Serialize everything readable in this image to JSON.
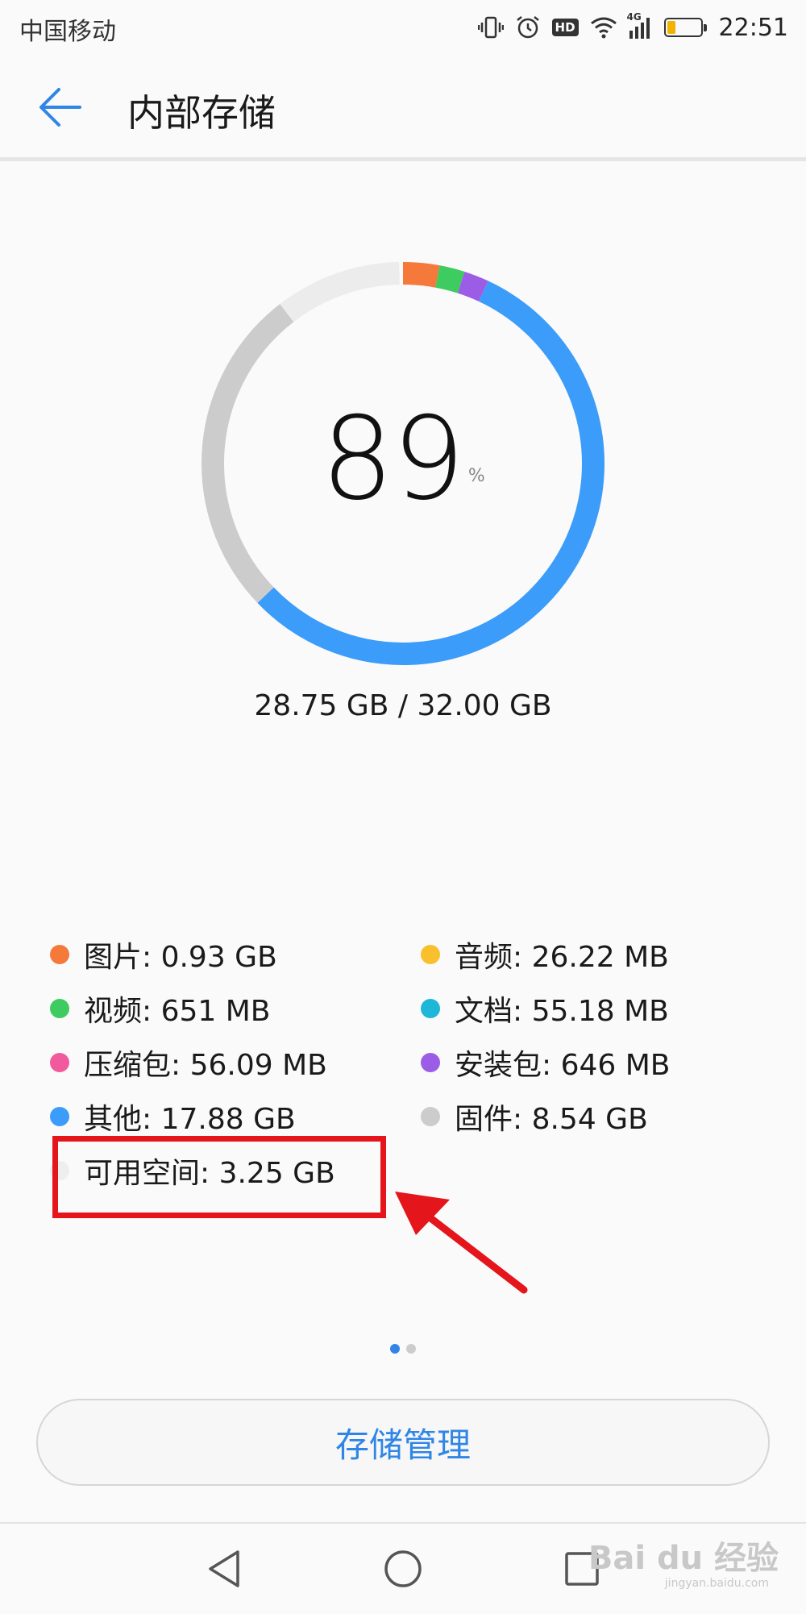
{
  "status_bar": {
    "carrier": "中国移动",
    "network": "4G",
    "hd": "HD",
    "time": "22:51",
    "battery_level": 0.28
  },
  "app_bar": {
    "title": "内部存储"
  },
  "storage": {
    "percent": "89",
    "percent_unit": "%",
    "usage": "28.75 GB / 32.00 GB"
  },
  "chart_data": {
    "type": "donut",
    "total_gb": 32.0,
    "segments": [
      {
        "name": "图片",
        "value_gb": 0.93,
        "color": "#f5793a"
      },
      {
        "name": "视频",
        "value_gb": 0.651,
        "color": "#3ecb5f"
      },
      {
        "name": "安装包",
        "value_gb": 0.646,
        "color": "#9b5de5"
      },
      {
        "name": "其他",
        "value_gb": 17.88,
        "color": "#3c9cf9"
      },
      {
        "name": "固件",
        "value_gb": 8.54,
        "color": "#cccccc"
      },
      {
        "name": "可用空间",
        "value_gb": 3.25,
        "color": "#ececec"
      }
    ]
  },
  "legend": {
    "items": [
      {
        "text": "图片: 0.93 GB",
        "color": "#f5793a"
      },
      {
        "text": "音频: 26.22 MB",
        "color": "#f9c02e"
      },
      {
        "text": "视频: 651 MB",
        "color": "#3ecb5f"
      },
      {
        "text": "文档: 55.18 MB",
        "color": "#1fb7d9"
      },
      {
        "text": "压缩包: 56.09 MB",
        "color": "#f15a9c"
      },
      {
        "text": "安装包: 646 MB",
        "color": "#9b5de5"
      },
      {
        "text": "其他: 17.88 GB",
        "color": "#3c9cf9"
      },
      {
        "text": "固件: 8.54 GB",
        "color": "#cccccc"
      },
      {
        "text": "可用空间: 3.25 GB",
        "color": "#eeeeee"
      }
    ]
  },
  "page_indicator": {
    "active_color": "#2f86e6",
    "inactive_color": "#cccccc"
  },
  "actions": {
    "manage_label": "存储管理"
  },
  "watermark": {
    "text": "Bai du 经验",
    "sub": "jingyan.baidu.com"
  }
}
